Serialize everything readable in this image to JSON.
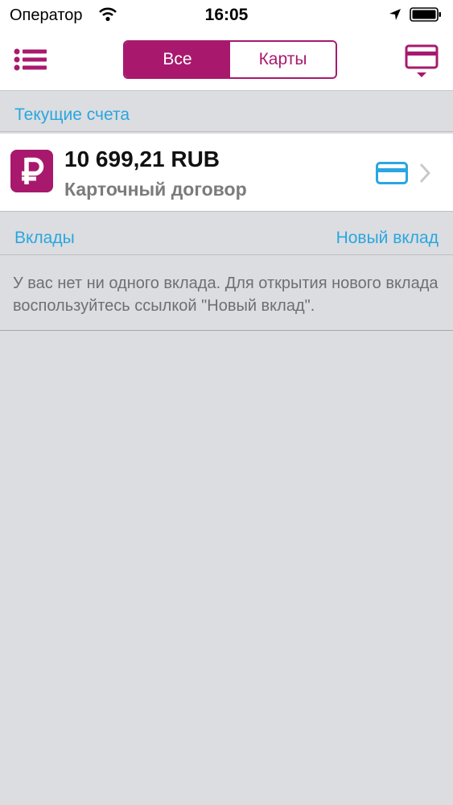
{
  "status_bar": {
    "carrier": "Оператор",
    "time": "16:05",
    "icons": [
      "wifi-icon",
      "location-arrow-icon",
      "battery-icon"
    ]
  },
  "nav": {
    "menu_icon": "list-menu-icon",
    "tabs": [
      {
        "label": "Все",
        "active": true
      },
      {
        "label": "Карты",
        "active": false
      }
    ],
    "card_icon": "card-dropdown-icon"
  },
  "current_accounts": {
    "header": "Текущие счета",
    "accounts": [
      {
        "icon": "ruble-icon",
        "amount": "10 699,21 RUB",
        "type": "Карточный договор",
        "trailing_icons": [
          "card-icon",
          "chevron-right-icon"
        ]
      }
    ]
  },
  "deposits": {
    "header": "Вклады",
    "action": "Новый вклад",
    "empty_message": "У вас нет ни одного вклада. Для открытия нового вклада воспользуйтесь ссылкой \"Новый вклад\"."
  },
  "colors": {
    "brand": "#a8196e",
    "link": "#2aa6e0",
    "background": "#dcdde0"
  }
}
